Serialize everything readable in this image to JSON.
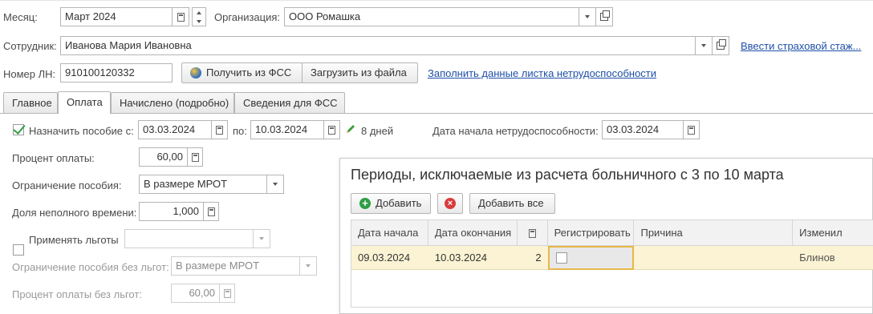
{
  "header": {
    "month_label": "Месяц:",
    "month_value": "Март 2024",
    "org_label": "Организация:",
    "org_value": "ООО Ромашка",
    "employee_label": "Сотрудник:",
    "employee_value": "Иванова Мария Ивановна",
    "insurance_link": "Ввести страховой стаж...",
    "ln_label": "Номер ЛН:",
    "ln_value": "910100120332",
    "get_fss_button": "Получить из ФСС",
    "load_file_button": "Загрузить из файла",
    "fill_link": "Заполнить данные листка нетрудоспособности"
  },
  "tabs": [
    {
      "label": "Главное",
      "active": false
    },
    {
      "label": "Оплата",
      "active": true
    },
    {
      "label": "Начислено (подробно)",
      "active": false
    },
    {
      "label": "Сведения для ФСС",
      "active": false
    }
  ],
  "payment": {
    "assign_label": "Назначить пособие с:",
    "assign_checked": true,
    "date_from": "03.03.2024",
    "to_label": "по:",
    "date_to": "10.03.2024",
    "days_text": "8 дней",
    "start_label": "Дата начала нетрудоспособности:",
    "start_value": "03.03.2024",
    "percent_label": "Процент оплаты:",
    "percent_value": "60,00",
    "limit_label": "Ограничение пособия:",
    "limit_value": "В размере МРОТ",
    "parttime_label": "Доля неполного времени:",
    "parttime_value": "1,000",
    "benefits_label": "Применять льготы",
    "benefits_checked": false,
    "limit_nobenefits_label": "Ограничение пособия без льгот:",
    "limit_nobenefits_value": "В размере МРОТ",
    "percent_nobenefits_label": "Процент оплаты без льгот:",
    "percent_nobenefits_value": "60,00"
  },
  "exclusions": {
    "title": "Периоды, исключаемые из расчета больничного с 3 по 10 марта",
    "add_button": "Добавить",
    "add_all_button": "Добавить все",
    "columns": [
      "Дата начала",
      "Дата окончания",
      "",
      "Регистрировать",
      "Причина",
      "Изменил"
    ],
    "rows": [
      {
        "start": "09.03.2024",
        "end": "10.03.2024",
        "days": "2",
        "register": false,
        "reason": "",
        "changed_by": "Блинов"
      }
    ]
  },
  "colors": {
    "accent_green": "#2f9e44",
    "link": "#1e4fa8",
    "selected_row": "#fbf3d3",
    "selected_cell_border": "#e6b84a",
    "delete_red": "#d93c3c"
  }
}
